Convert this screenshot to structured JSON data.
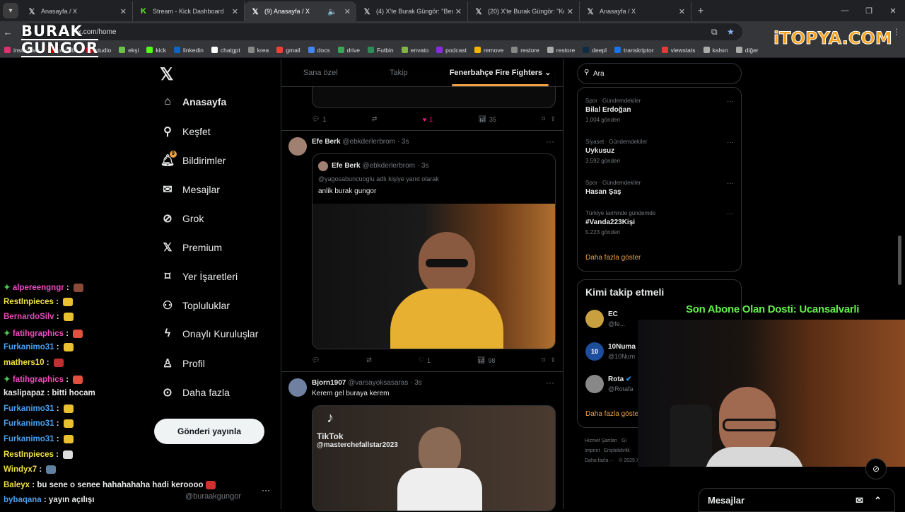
{
  "browser": {
    "tabs": [
      {
        "label": "Anasayfa / X",
        "icon": "x-icon",
        "active": false
      },
      {
        "label": "Stream - Kick Dashboard",
        "icon": "kick-icon",
        "active": false
      },
      {
        "label": "(9) Anasayfa / X",
        "icon": "x-icon",
        "active": true
      },
      {
        "label": "(4) X'te Burak Güngör: \"Berke Ö",
        "icon": "x-icon",
        "active": false
      },
      {
        "label": "(20) X'te Burak Güngör: \"Kerem",
        "icon": "x-icon",
        "active": false
      },
      {
        "label": "Anasayfa / X",
        "icon": "x-icon",
        "active": false
      }
    ],
    "url": "x.com/home",
    "bookmarks": [
      "instagram",
      "youtube",
      "studio",
      "ekşi",
      "kick",
      "linkedin",
      "chatgpt",
      "krea",
      "gmail",
      "docs",
      "drive",
      "Futbin",
      "envato",
      "podcast",
      "remove",
      "restore",
      "restore",
      "deepl",
      "transkriptor",
      "viewstats",
      "kalsın",
      "diğer"
    ]
  },
  "overlay": {
    "logo_line1": "BURAK",
    "logo_line2": "GUNGOR",
    "sponsor": "iTOPYA.COM",
    "sub_note": "Son Abone Olan Dosti: Ucansalvarli"
  },
  "nav": {
    "items": [
      "Anasayfa",
      "Keşfet",
      "Bildirimler",
      "Mesajlar",
      "Grok",
      "Premium",
      "Yer İşaretleri",
      "Topluluklar",
      "Onaylı Kuruluşlar",
      "Profil",
      "Daha fazla"
    ],
    "notif_badge": "9",
    "post_button": "Gönderi yayınla",
    "account_handle": "@buraakgungor"
  },
  "feed": {
    "tabs": [
      "Sana özel",
      "Takip",
      "Fenerbahçe Fire Fighters"
    ],
    "top_actions": {
      "replies": "1",
      "likes": "1",
      "views": "35"
    },
    "tweet1": {
      "name": "Efe Berk",
      "handle": "@ebkderlerbrom · 3s",
      "quote_name": "Efe Berk",
      "quote_handle": "@ebkderlerbrom · 3s",
      "reply_to": "@yagosabuncuoglu adlı kişiye yanıt olarak",
      "text": "anlik burak gungor",
      "likes": "1",
      "views": "98"
    },
    "tweet2": {
      "name": "Bjorn1907",
      "handle": "@varsayoksasaras · 3s",
      "text": "Kerem gel buraya kerem",
      "tiktok_brand": "TikTok",
      "tiktok_user": "@masterchefallstar2023"
    }
  },
  "right": {
    "search_placeholder": "Ara",
    "trends": [
      {
        "category": "Spor · Gündemdekiler",
        "name": "Bilal Erdoğan",
        "count": "1.004 gönderi"
      },
      {
        "category": "Siyaset · Gündemdekiler",
        "name": "Uykusuz",
        "count": "3.592 gönderi"
      },
      {
        "category": "Spor · Gündemdekiler",
        "name": "Hasan Şaş",
        "count": ""
      },
      {
        "category": "Türkiye tarihinde gündemde",
        "name": "#Vanda223Kişi",
        "count": "5.223 gönderi"
      }
    ],
    "show_more": "Daha fazla göster",
    "who_to_follow_title": "Kimi takip etmeli",
    "who_to_follow": [
      {
        "name": "EC",
        "handle": "@fe..."
      },
      {
        "name": "10Numa",
        "handle": "@10Num"
      },
      {
        "name": "Rota",
        "handle": "@Rotafa"
      }
    ],
    "who_show_more": "Daha fazla göste",
    "footer": [
      "Hizmet Şartları",
      "Gi",
      "Imprint",
      "Erişilebilirlik",
      "Daha fazla ···",
      "© 2025 X"
    ]
  },
  "chat": [
    {
      "user": "alpereengngr",
      "msg": "",
      "color": "#f04ac0",
      "badge": true
    },
    {
      "user": "RestInpieces",
      "msg": "",
      "color": "#f0e040",
      "badge": false
    },
    {
      "user": "BernardoSilv",
      "msg": "",
      "color": "#e04ab8",
      "badge": false
    },
    {
      "user": "fatihgraphics",
      "msg": "",
      "color": "#f04ac0",
      "badge": true
    },
    {
      "user": "Furkanimo31",
      "msg": "",
      "color": "#4aa0f0",
      "badge": false
    },
    {
      "user": "mathers10",
      "msg": "",
      "color": "#f0e040",
      "badge": false
    },
    {
      "user": "fatihgraphics",
      "msg": "",
      "color": "#f04ac0",
      "badge": true
    },
    {
      "user": "kaslipapaz",
      "msg": "bitti hocam",
      "color": "#e7e9ea",
      "badge": false
    },
    {
      "user": "Furkanimo31",
      "msg": "",
      "color": "#4aa0f0",
      "badge": false
    },
    {
      "user": "Furkanimo31",
      "msg": "",
      "color": "#4aa0f0",
      "badge": false
    },
    {
      "user": "Furkanimo31",
      "msg": "",
      "color": "#4aa0f0",
      "badge": false
    },
    {
      "user": "RestInpieces",
      "msg": "",
      "color": "#f0e040",
      "badge": false
    },
    {
      "user": "Windyx7",
      "msg": "",
      "color": "#f0e040",
      "badge": false
    },
    {
      "user": "Baleyx",
      "msg": "bu sene o senee hahahahaha hadi keroooo",
      "color": "#f0e040",
      "badge": false
    },
    {
      "user": "bybaqana",
      "msg": "yayın açılışı",
      "color": "#4aa0f0",
      "badge": false
    }
  ],
  "messages_bar": {
    "label": "Mesajlar"
  },
  "colors": {
    "accent": "#f0a040",
    "chat_badge": "#4ad04a"
  }
}
